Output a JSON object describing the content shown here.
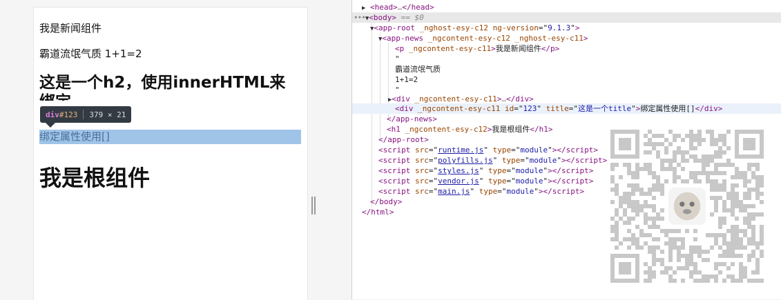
{
  "page": {
    "p1": "我是新闻组件",
    "p2": "霸道流氓气质 1+1=2",
    "h2": "这是一个h2，使用innerHTML来绑定",
    "highlighted_div": "绑定属性使用[]",
    "h1": "我是根组件"
  },
  "inspector_tooltip": {
    "tag": "div",
    "id": "#123",
    "size": "379 × 21"
  },
  "devtools": {
    "head": {
      "open": "<head>",
      "ellipsis": "…",
      "close": "</head>"
    },
    "body": {
      "open": "<body>",
      "marker": "== $0"
    },
    "app_root": {
      "name": "app-root",
      "attr1": "_nghost-esy-c12",
      "attr2_name": "ng-version",
      "attr2_val": "9.1.3"
    },
    "app_news": {
      "name": "app-news",
      "attr1": "_ngcontent-esy-c12",
      "attr2": "_nghost-esy-c11"
    },
    "p_line": {
      "attr": "_ngcontent-esy-c11",
      "text": "我是新闻组件"
    },
    "quote1": "\"",
    "text1": "霸道流氓气质",
    "text2": "1+1=2",
    "quote2": "\"",
    "div_collapsed": {
      "attr": "_ngcontent-esy-c11",
      "ellipsis": "…"
    },
    "div_id": {
      "attr": "_ngcontent-esy-c11",
      "id_name": "id",
      "id_val": "123",
      "title_name": "title",
      "title_val": "这是一个title",
      "text": "绑定属性使用[]"
    },
    "app_news_close": "</app-news>",
    "h1_line": {
      "attr": "_ngcontent-esy-c12",
      "text": "我是根组件"
    },
    "app_root_close": "</app-root>",
    "scripts": [
      {
        "src": "runtime.js",
        "type": "module"
      },
      {
        "src": "polyfills.js",
        "type": "module"
      },
      {
        "src": "styles.js",
        "type": "module"
      },
      {
        "src": "vendor.js",
        "type": "module"
      },
      {
        "src": "main.js",
        "type": "module"
      }
    ],
    "body_close": "</body>",
    "html_close": "</html>"
  },
  "colors": {
    "highlight": "#9fc4e7",
    "tooltip_bg": "#333a44",
    "tag": "#881280",
    "attr_name": "#994500",
    "attr_value": "#1a1aa6"
  }
}
